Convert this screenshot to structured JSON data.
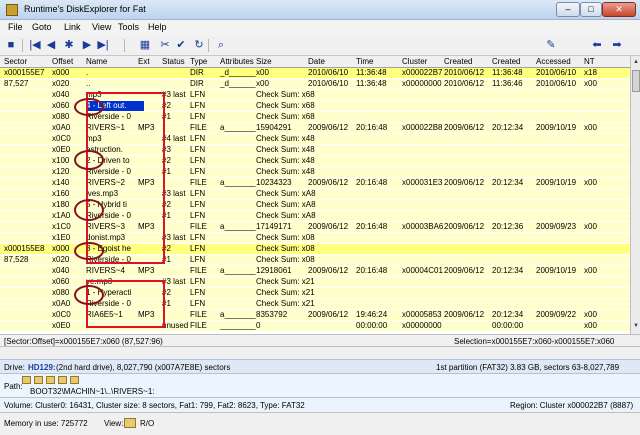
{
  "window": {
    "title": "Runtime's DiskExplorer for Fat",
    "controls": {
      "minimize": "–",
      "maximize": "□",
      "close": "✕"
    }
  },
  "menu": [
    "File",
    "Goto",
    "Link",
    "View",
    "Tools",
    "Help"
  ],
  "toolbar": {
    "icons": [
      "save-icon",
      "first-icon",
      "prev-block-icon",
      "jump-icon",
      "next-block-icon",
      "last-icon",
      "table-icon",
      "cut-icon",
      "check-icon",
      "refresh-icon",
      "find-icon",
      "bookmark-icon",
      "back-arrow-icon",
      "forward-arrow-icon"
    ],
    "glyphs": [
      "■",
      "|◀",
      "◀",
      "✱",
      "▶",
      "▶|",
      "▦",
      "✂",
      "✔",
      "↻",
      "⌕",
      "✎",
      "⬅",
      "➡"
    ]
  },
  "columns": [
    "Sector",
    "Offset",
    "Name",
    "Ext",
    "Status",
    "Type",
    "Attributes",
    "Size",
    "Date",
    "Time",
    "Cluster",
    "Created",
    "Created",
    "Accessed",
    "NT"
  ],
  "rows": [
    {
      "hl": true,
      "cells": [
        "x000155E7",
        "x000",
        ".",
        "",
        "",
        "DIR",
        "_d______",
        "x00",
        "2010/06/10",
        "11:36:48",
        "x000022B7",
        "2010/06/12",
        "11:36:48",
        "2010/06/10",
        "x18"
      ]
    },
    {
      "cells": [
        "87,527",
        "x020",
        "..",
        "",
        "",
        "DIR",
        "_d______",
        "x00",
        "2010/06/10",
        "11:36:48",
        "x00000000",
        "2010/06/12",
        "11:36:46",
        "2010/06/10",
        "x00"
      ]
    },
    {
      "cells": [
        "",
        "x040",
        "mp3",
        "",
        "#3 last",
        "LFN",
        "",
        "Check Sum: x68",
        "",
        "",
        "",
        "",
        "",
        "",
        ""
      ]
    },
    {
      "cells": [
        "",
        "x060",
        "4 - Left out.",
        "",
        "#2",
        "LFN",
        "",
        "Check Sum: x68",
        "",
        "",
        "",
        "",
        "",
        "",
        ""
      ],
      "sel": true
    },
    {
      "cells": [
        "",
        "x080",
        "Riverside - 0",
        "",
        "#1",
        "LFN",
        "",
        "Check Sum: x68",
        "",
        "",
        "",
        "",
        "",
        "",
        ""
      ]
    },
    {
      "cells": [
        "",
        "x0A0",
        "RIVERS~1",
        "MP3",
        "",
        "FILE",
        "a_______",
        "15904291",
        "2009/06/12",
        "20:16:48",
        "x000022B8",
        "2009/06/12",
        "20:12:34",
        "2009/10/19",
        "x00"
      ]
    },
    {
      "cells": [
        "",
        "x0C0",
        "mp3",
        "",
        "#4 last",
        "LFN",
        "",
        "Check Sum: x48",
        "",
        "",
        "",
        "",
        "",
        "",
        ""
      ]
    },
    {
      "cells": [
        "",
        "x0E0",
        "estruction.",
        "",
        "#3",
        "LFN",
        "",
        "Check Sum: x48",
        "",
        "",
        "",
        "",
        "",
        "",
        ""
      ]
    },
    {
      "cells": [
        "",
        "x100",
        "2 - Driven to",
        "",
        "#2",
        "LFN",
        "",
        "Check Sum: x48",
        "",
        "",
        "",
        "",
        "",
        "",
        ""
      ]
    },
    {
      "cells": [
        "",
        "x120",
        "Riverside - 0",
        "",
        "#1",
        "LFN",
        "",
        "Check Sum: x48",
        "",
        "",
        "",
        "",
        "",
        "",
        ""
      ]
    },
    {
      "cells": [
        "",
        "x140",
        "RIVERS~2",
        "MP3",
        "",
        "FILE",
        "a_______",
        "10234323",
        "2009/06/12",
        "20:16:48",
        "x000031E3",
        "2009/06/12",
        "20:12:34",
        "2009/10/19",
        "x00"
      ]
    },
    {
      "cells": [
        "",
        "x160",
        "ives.mp3",
        "",
        "#3 last",
        "LFN",
        "",
        "Check Sum: xA8",
        "",
        "",
        "",
        "",
        "",
        "",
        ""
      ]
    },
    {
      "cells": [
        "",
        "x180",
        "5 - Hybrid ti",
        "",
        "#2",
        "LFN",
        "",
        "Check Sum: xA8",
        "",
        "",
        "",
        "",
        "",
        "",
        ""
      ]
    },
    {
      "cells": [
        "",
        "x1A0",
        "Riverside - 0",
        "",
        "#1",
        "LFN",
        "",
        "Check Sum: xA8",
        "",
        "",
        "",
        "",
        "",
        "",
        ""
      ]
    },
    {
      "cells": [
        "",
        "x1C0",
        "RIVERS~3",
        "MP3",
        "",
        "FILE",
        "a_______",
        "17149171",
        "2009/06/12",
        "20:16:48",
        "x00003BA6",
        "2009/06/12",
        "20:12:36",
        "2009/09/23",
        "x00"
      ]
    },
    {
      "cells": [
        "",
        "x1E0",
        "donist.mp3",
        "",
        "#3 last",
        "LFN",
        "",
        "Check Sum: x08",
        "",
        "",
        "",
        "",
        "",
        "",
        ""
      ]
    },
    {
      "hl": true,
      "cells": [
        "x000155E8",
        "x000",
        "3 - Egoist he",
        "",
        "#2",
        "LFN",
        "",
        "Check Sum: x08",
        "",
        "",
        "",
        "",
        "",
        "",
        ""
      ]
    },
    {
      "cells": [
        "87,528",
        "x020",
        "Riverside - 0",
        "",
        "#1",
        "LFN",
        "",
        "Check Sum: x08",
        "",
        "",
        "",
        "",
        "",
        "",
        ""
      ]
    },
    {
      "cells": [
        "",
        "x040",
        "RIVERS~4",
        "MP3",
        "",
        "FILE",
        "a_______",
        "12918061",
        "2009/06/12",
        "20:16:48",
        "x00004C01",
        "2009/06/12",
        "20:12:34",
        "2009/10/19",
        "x00"
      ]
    },
    {
      "cells": [
        "",
        "x060",
        "ve.mp3",
        "",
        "#3 last",
        "LFN",
        "",
        "Check Sum: x21",
        "",
        "",
        "",
        "",
        "",
        "",
        ""
      ]
    },
    {
      "cells": [
        "",
        "x080",
        "1 - Hyperacti",
        "",
        "#2",
        "LFN",
        "",
        "Check Sum: x21",
        "",
        "",
        "",
        "",
        "",
        "",
        ""
      ]
    },
    {
      "cells": [
        "",
        "x0A0",
        "Riverside - 0",
        "",
        "#1",
        "LFN",
        "",
        "Check Sum: x21",
        "",
        "",
        "",
        "",
        "",
        "",
        ""
      ]
    },
    {
      "cells": [
        "",
        "x0C0",
        "RIA6E5~1",
        "MP3",
        "",
        "FILE",
        "a_______",
        "8353792",
        "2009/06/12",
        "19:46:24",
        "x00005853",
        "2009/06/12",
        "20:12:34",
        "2009/09/22",
        "x00"
      ]
    },
    {
      "cells": [
        "",
        "x0E0",
        "",
        "",
        "unused",
        "FILE",
        "________",
        "0",
        "",
        "00:00:00",
        "x00000000",
        "",
        "00:00:00",
        "",
        "x00"
      ]
    }
  ],
  "status": {
    "location": "[Sector:Offset]=x000155E7:x060 (87,527:96)",
    "selection": "Selection=x000155E7:x060-x000155E7:x060"
  },
  "drive": {
    "label": "Drive:",
    "id": "HD129:",
    "desc": "(2nd hard drive), 8,027,790 (x007A7E8E) sectors",
    "partition": "1st partition (FAT32) 3.83 GB, sectors 63-8,027,789"
  },
  "path": {
    "label": "Path:",
    "value": "BOOT32\\MACHIN~1\\..\\RIVERS~1:"
  },
  "volume": {
    "info": "Volume: Cluster0: 16431, Cluster size: 8 sectors, Fat1: 799, Fat2: 8623, Type: FAT32",
    "region": "Region:  Cluster x000022B7 (8887)"
  },
  "memory": {
    "label": "Memory in use: 725772",
    "view_label": "View:",
    "view_value": "R/O"
  }
}
